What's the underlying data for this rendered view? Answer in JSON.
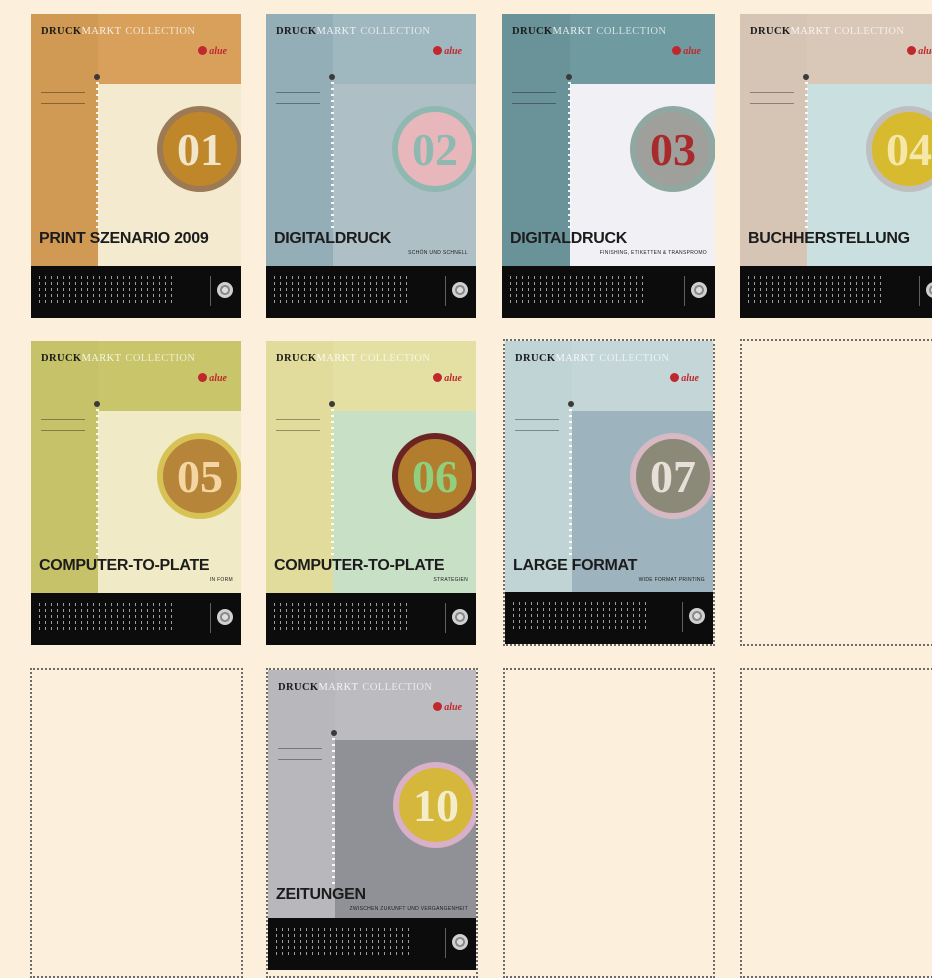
{
  "masthead": {
    "word1": "DRUCK",
    "word2": "MARKT",
    "word3": "COLLECTION"
  },
  "brand": "alue",
  "covers": [
    {
      "number": "01",
      "title": "PRINT SZENARIO 2009",
      "subtitle": "",
      "colors": {
        "bg": "#d9a05c",
        "band": "#d09a55",
        "panel": "#f3ead0",
        "circle": "#c0872a",
        "ring": "#9b7a55",
        "digits": "#f1e6c9"
      }
    },
    {
      "number": "02",
      "title": "DIGITALDRUCK",
      "subtitle": "SCHÖN UND SCHNELL",
      "colors": {
        "bg": "#9fb7be",
        "band": "#93aeb6",
        "panel": "#aebfc5",
        "circle": "#e8b7bc",
        "ring": "#8fb8b1",
        "digits": "#8fb8b1"
      }
    },
    {
      "number": "03",
      "title": "DIGITALDRUCK",
      "subtitle": "FINISHING, ETIKETTEN & TRANSPROMO",
      "colors": {
        "bg": "#6e9aa0",
        "band": "#6a9399",
        "panel": "#f1f1f5",
        "circle": "#9fa09b",
        "ring": "#8fa8a2",
        "digits": "#a92a2d"
      }
    },
    {
      "number": "04",
      "title": "BUCHHERSTELLUNG",
      "subtitle": "",
      "colors": {
        "bg": "#d9c8b8",
        "band": "#d6c5b4",
        "panel": "#c9dfe0",
        "circle": "#d7ba2d",
        "ring": "#bfbfbf",
        "digits": "#f5e7a8"
      }
    },
    {
      "number": "05",
      "title": "COMPUTER-TO-PLATE",
      "subtitle": "IN FORM",
      "colors": {
        "bg": "#c8c56a",
        "band": "#c6c26a",
        "panel": "#f0ebc6",
        "circle": "#b7853a",
        "ring": "#d7c255",
        "digits": "#f3d6a2"
      }
    },
    {
      "number": "06",
      "title": "COMPUTER-TO-PLATE",
      "subtitle": "STRATEGIEN",
      "colors": {
        "bg": "#e4e0a4",
        "band": "#e1dc9b",
        "panel": "#c8e1c6",
        "circle": "#b27d2d",
        "ring": "#6b2424",
        "digits": "#8fcf7e"
      }
    },
    {
      "number": "07",
      "title": "LARGE FORMAT",
      "subtitle": "WIDE FORMAT PRINTING",
      "colors": {
        "bg": "#c4d6d8",
        "band": "#c0d3d5",
        "panel": "#9db3bd",
        "circle": "#8b8a78",
        "ring": "#d7b9c3",
        "digits": "#e7e0d9"
      }
    },
    {
      "number": "10",
      "title": "ZEITUNGEN",
      "subtitle": "ZWISCHEN ZUKUNFT UND VERGANGENHEIT",
      "colors": {
        "bg": "#bcbcc0",
        "band": "#b8b8bc",
        "panel": "#8f9196",
        "circle": "#d5b83b",
        "ring": "#d8b0c9",
        "digits": "#f5edc9"
      }
    }
  ]
}
